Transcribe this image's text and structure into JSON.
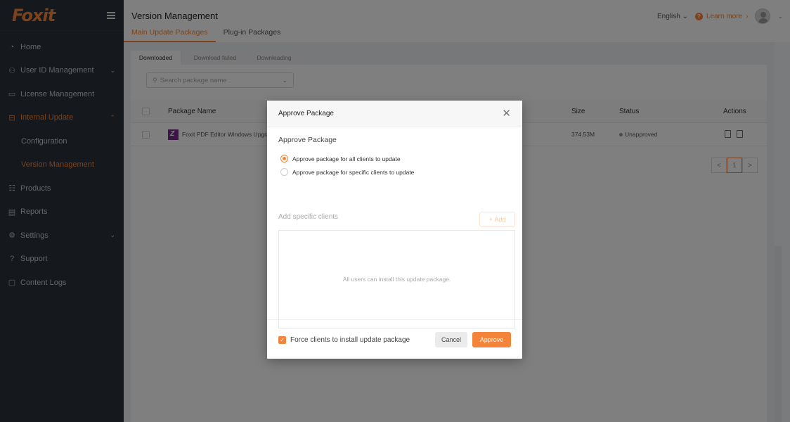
{
  "brand": {
    "logo_text": "Foxit",
    "accent_color": "#f4843a"
  },
  "sidebar": {
    "items": [
      {
        "label": "Home",
        "icon": "dashboard-icon"
      },
      {
        "label": "User ID Management",
        "icon": "users-icon",
        "expandable": true
      },
      {
        "label": "License Management",
        "icon": "cast-icon"
      },
      {
        "label": "Internal Update",
        "icon": "update-icon",
        "expandable": true,
        "expanded": true,
        "active": true,
        "children": [
          {
            "label": "Configuration"
          },
          {
            "label": "Version Management",
            "active": true
          }
        ]
      },
      {
        "label": "Products",
        "icon": "list-icon"
      },
      {
        "label": "Reports",
        "icon": "report-icon"
      },
      {
        "label": "Settings",
        "icon": "gear-icon",
        "expandable": true
      },
      {
        "label": "Support",
        "icon": "help-icon"
      },
      {
        "label": "Content Logs",
        "icon": "clipboard-icon"
      }
    ]
  },
  "header": {
    "title": "Version Management",
    "language": "English",
    "learn_more": "Learn more"
  },
  "main_tabs": [
    {
      "label": "Main Update Packages",
      "active": true
    },
    {
      "label": "Plug-in Packages"
    }
  ],
  "sub_tabs": [
    {
      "label": "Downloaded",
      "active": true
    },
    {
      "label": "Download failed"
    },
    {
      "label": "Downloading"
    }
  ],
  "search": {
    "placeholder": "Search package name"
  },
  "table": {
    "columns": [
      "Package Name",
      "Size",
      "Status",
      "Actions"
    ],
    "rows": [
      {
        "name": "Foxit PDF Editor Windows Upgra",
        "size": "374.53M",
        "status": "Unapproved"
      }
    ]
  },
  "pagination": {
    "current": "1",
    "prev": "<",
    "next": ">"
  },
  "modal": {
    "title": "Approve Package",
    "section_label": "Approve Package",
    "options": [
      {
        "label": "Approve package for all clients to update",
        "checked": true
      },
      {
        "label": "Approve package for specific clients to update",
        "checked": false
      }
    ],
    "add_clients_label": "Add specific clients",
    "add_button": "Add",
    "empty_message": "All users can install this update package.",
    "force_label": "Force clients to install update package",
    "force_checked": true,
    "cancel": "Cancel",
    "approve": "Approve"
  }
}
